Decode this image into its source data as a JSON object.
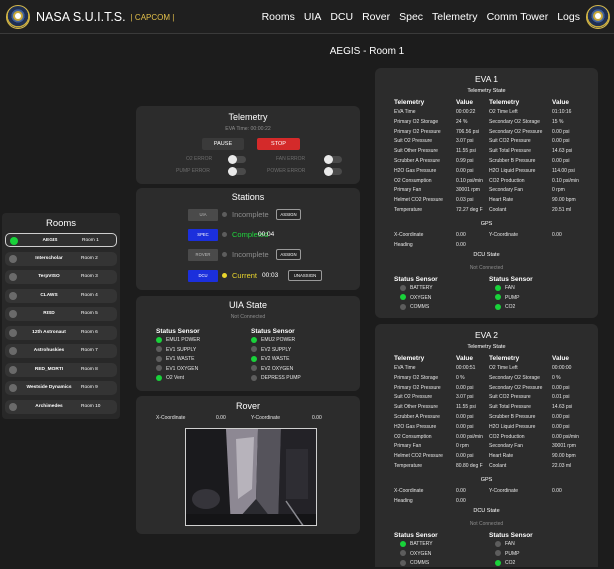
{
  "header": {
    "brand": "NASA S.U.I.T.S.",
    "sub": "| CAPCOM |",
    "nav": [
      "Rooms",
      "UIA",
      "DCU",
      "Rover",
      "Spec",
      "Telemetry",
      "Comm Tower",
      "Logs"
    ]
  },
  "page_title": "AEGIS - Room 1",
  "rooms": {
    "title": "Rooms",
    "items": [
      {
        "name": "AEGIS",
        "room": "Room 1",
        "selected": true
      },
      {
        "name": "Interscholar",
        "room": "Room 2"
      },
      {
        "name": "TerpVISO",
        "room": "Room 3"
      },
      {
        "name": "CLAWS",
        "room": "Room 4"
      },
      {
        "name": "RISD",
        "room": "Room 5"
      },
      {
        "name": "12th Astronaut",
        "room": "Room 6"
      },
      {
        "name": "Astrohuskies",
        "room": "Room 7"
      },
      {
        "name": "RED_MORTI",
        "room": "Room 8"
      },
      {
        "name": "Westside Dynamics",
        "room": "Room 9"
      },
      {
        "name": "Archimedes",
        "room": "Room 10"
      }
    ]
  },
  "telemetry": {
    "title": "Telemetry",
    "eva_time": "EVA Time: 00:00:22",
    "pause": "PAUSE",
    "stop": "STOP",
    "o2_error": "O2 ERROR",
    "fan_error": "FAN ERROR",
    "pump_error": "PUMP ERROR",
    "power_error": "POWER ERROR"
  },
  "stations": {
    "title": "Stations",
    "rows": [
      {
        "tag": "UIA",
        "status": "Incomplete",
        "button": "ASSIGN"
      },
      {
        "tag": "SPEC",
        "status": "Completed",
        "time": "00:04"
      },
      {
        "tag": "ROVER",
        "status": "Incomplete",
        "button": "ASSIGN"
      },
      {
        "tag": "DCU",
        "status": "Current",
        "time": "00:03",
        "button": "UNASSIGN"
      }
    ]
  },
  "uia": {
    "title": "UIA State",
    "conn": "Not Connected",
    "head": "Status Sensor",
    "left": [
      {
        "label": "EMU1 POWER",
        "on": true
      },
      {
        "label": "EV1 SUPPLY",
        "on": false
      },
      {
        "label": "EV1 WASTE",
        "on": false
      },
      {
        "label": "EV1 OXYGEN",
        "on": false
      },
      {
        "label": "O2 Vent",
        "on": true
      }
    ],
    "right": [
      {
        "label": "EMU2 POWER",
        "on": true
      },
      {
        "label": "EV2 SUPPLY",
        "on": false
      },
      {
        "label": "EV2 WASTE",
        "on": true
      },
      {
        "label": "EV2 OXYGEN",
        "on": false
      },
      {
        "label": "DEPRESS PUMP",
        "on": false
      }
    ]
  },
  "rover": {
    "title": "Rover",
    "x_label": "X-Coordinate",
    "x": "0.00",
    "y_label": "Y-Coordinate",
    "y": "0.00"
  },
  "eva": [
    {
      "title": "EVA 1",
      "state": "Telemetry State",
      "col_tel": "Telemetry",
      "col_val": "Value",
      "left": [
        [
          "EVA Time",
          "00:00:22"
        ],
        [
          "Primary O2 Storage",
          "24 %"
        ],
        [
          "Primary O2 Pressure",
          "706.56 psi"
        ],
        [
          "Suit O2 Pressure",
          "3.07 psi"
        ],
        [
          "Suit Other Pressure",
          "11.55 psi"
        ],
        [
          "Scrubber A Pressure",
          "0.99 psi"
        ],
        [
          "H2O Gas Pressure",
          "0.00 psi"
        ],
        [
          "O2 Consumption",
          "0.10 psi/min"
        ],
        [
          "Primary Fan",
          "30001 rpm"
        ],
        [
          "Helmet CO2 Pressure",
          "0.03 psi"
        ],
        [
          "Temperature",
          "72.27 deg F"
        ]
      ],
      "right": [
        [
          "O2 Time Left",
          "01:10:16"
        ],
        [
          "Secondary O2 Storage",
          "15 %"
        ],
        [
          "Secondary O2 Pressure",
          "0.00 psi"
        ],
        [
          "Suit CO2 Pressure",
          "0.00 psi"
        ],
        [
          "Suit Total Pressure",
          "14.63 psi"
        ],
        [
          "Scrubber B Pressure",
          "0.00 psi"
        ],
        [
          "H2O Liquid Pressure",
          "114.00 psi"
        ],
        [
          "CO2 Production",
          "0.10 psi/min"
        ],
        [
          "Secondary Fan",
          "0 rpm"
        ],
        [
          "Heart Rate",
          "90.00 bpm"
        ],
        [
          "Coolant",
          "20.51 ml"
        ]
      ],
      "gps": "GPS",
      "x_label": "X-Coordinate",
      "x": "0.00",
      "y_label": "Y-Coordinate",
      "y": "0.00",
      "h_label": "Heading",
      "h": "0.00",
      "dcu": "DCU State",
      "dcu_conn": "Not Connected",
      "sensor_head": "Status Sensor",
      "sens_left": [
        [
          "BATTERY",
          false
        ],
        [
          "OXYGEN",
          true
        ],
        [
          "COMMS",
          false
        ]
      ],
      "sens_right": [
        [
          "FAN",
          true
        ],
        [
          "PUMP",
          true
        ],
        [
          "CO2",
          true
        ]
      ]
    },
    {
      "title": "EVA 2",
      "state": "Telemetry State",
      "col_tel": "Telemetry",
      "col_val": "Value",
      "left": [
        [
          "EVA Time",
          "00:00:51"
        ],
        [
          "Primary O2 Storage",
          "0 %"
        ],
        [
          "Primary O2 Pressure",
          "0.00 psi"
        ],
        [
          "Suit O2 Pressure",
          "3.07 psi"
        ],
        [
          "Suit Other Pressure",
          "11.55 psi"
        ],
        [
          "Scrubber A Pressure",
          "0.00 psi"
        ],
        [
          "H2O Gas Pressure",
          "0.00 psi"
        ],
        [
          "O2 Consumption",
          "0.00 psi/min"
        ],
        [
          "Primary Fan",
          "0 rpm"
        ],
        [
          "Helmet CO2 Pressure",
          "0.00 psi"
        ],
        [
          "Temperature",
          "80.80 deg F"
        ]
      ],
      "right": [
        [
          "O2 Time Left",
          "00:00:00"
        ],
        [
          "Secondary O2 Storage",
          "0 %"
        ],
        [
          "Secondary O2 Pressure",
          "0.00 psi"
        ],
        [
          "Suit CO2 Pressure",
          "0.01 psi"
        ],
        [
          "Suit Total Pressure",
          "14.63 psi"
        ],
        [
          "Scrubber B Pressure",
          "0.00 psi"
        ],
        [
          "H2O Liquid Pressure",
          "0.00 psi"
        ],
        [
          "CO2 Production",
          "0.00 psi/min"
        ],
        [
          "Secondary Fan",
          "30001 rpm"
        ],
        [
          "Heart Rate",
          "90.00 bpm"
        ],
        [
          "Coolant",
          "22.03 ml"
        ]
      ],
      "gps": "GPS",
      "x_label": "X-Coordinate",
      "x": "0.00",
      "y_label": "Y-Coordinate",
      "y": "0.00",
      "h_label": "Heading",
      "h": "0.00",
      "dcu": "DCU State",
      "dcu_conn": "Not Connected",
      "sensor_head": "Status Sensor",
      "sens_left": [
        [
          "BATTERY",
          true
        ],
        [
          "OXYGEN",
          false
        ],
        [
          "COMMS",
          false
        ]
      ],
      "sens_right": [
        [
          "FAN",
          false
        ],
        [
          "PUMP",
          false
        ],
        [
          "CO2",
          true
        ]
      ]
    }
  ]
}
